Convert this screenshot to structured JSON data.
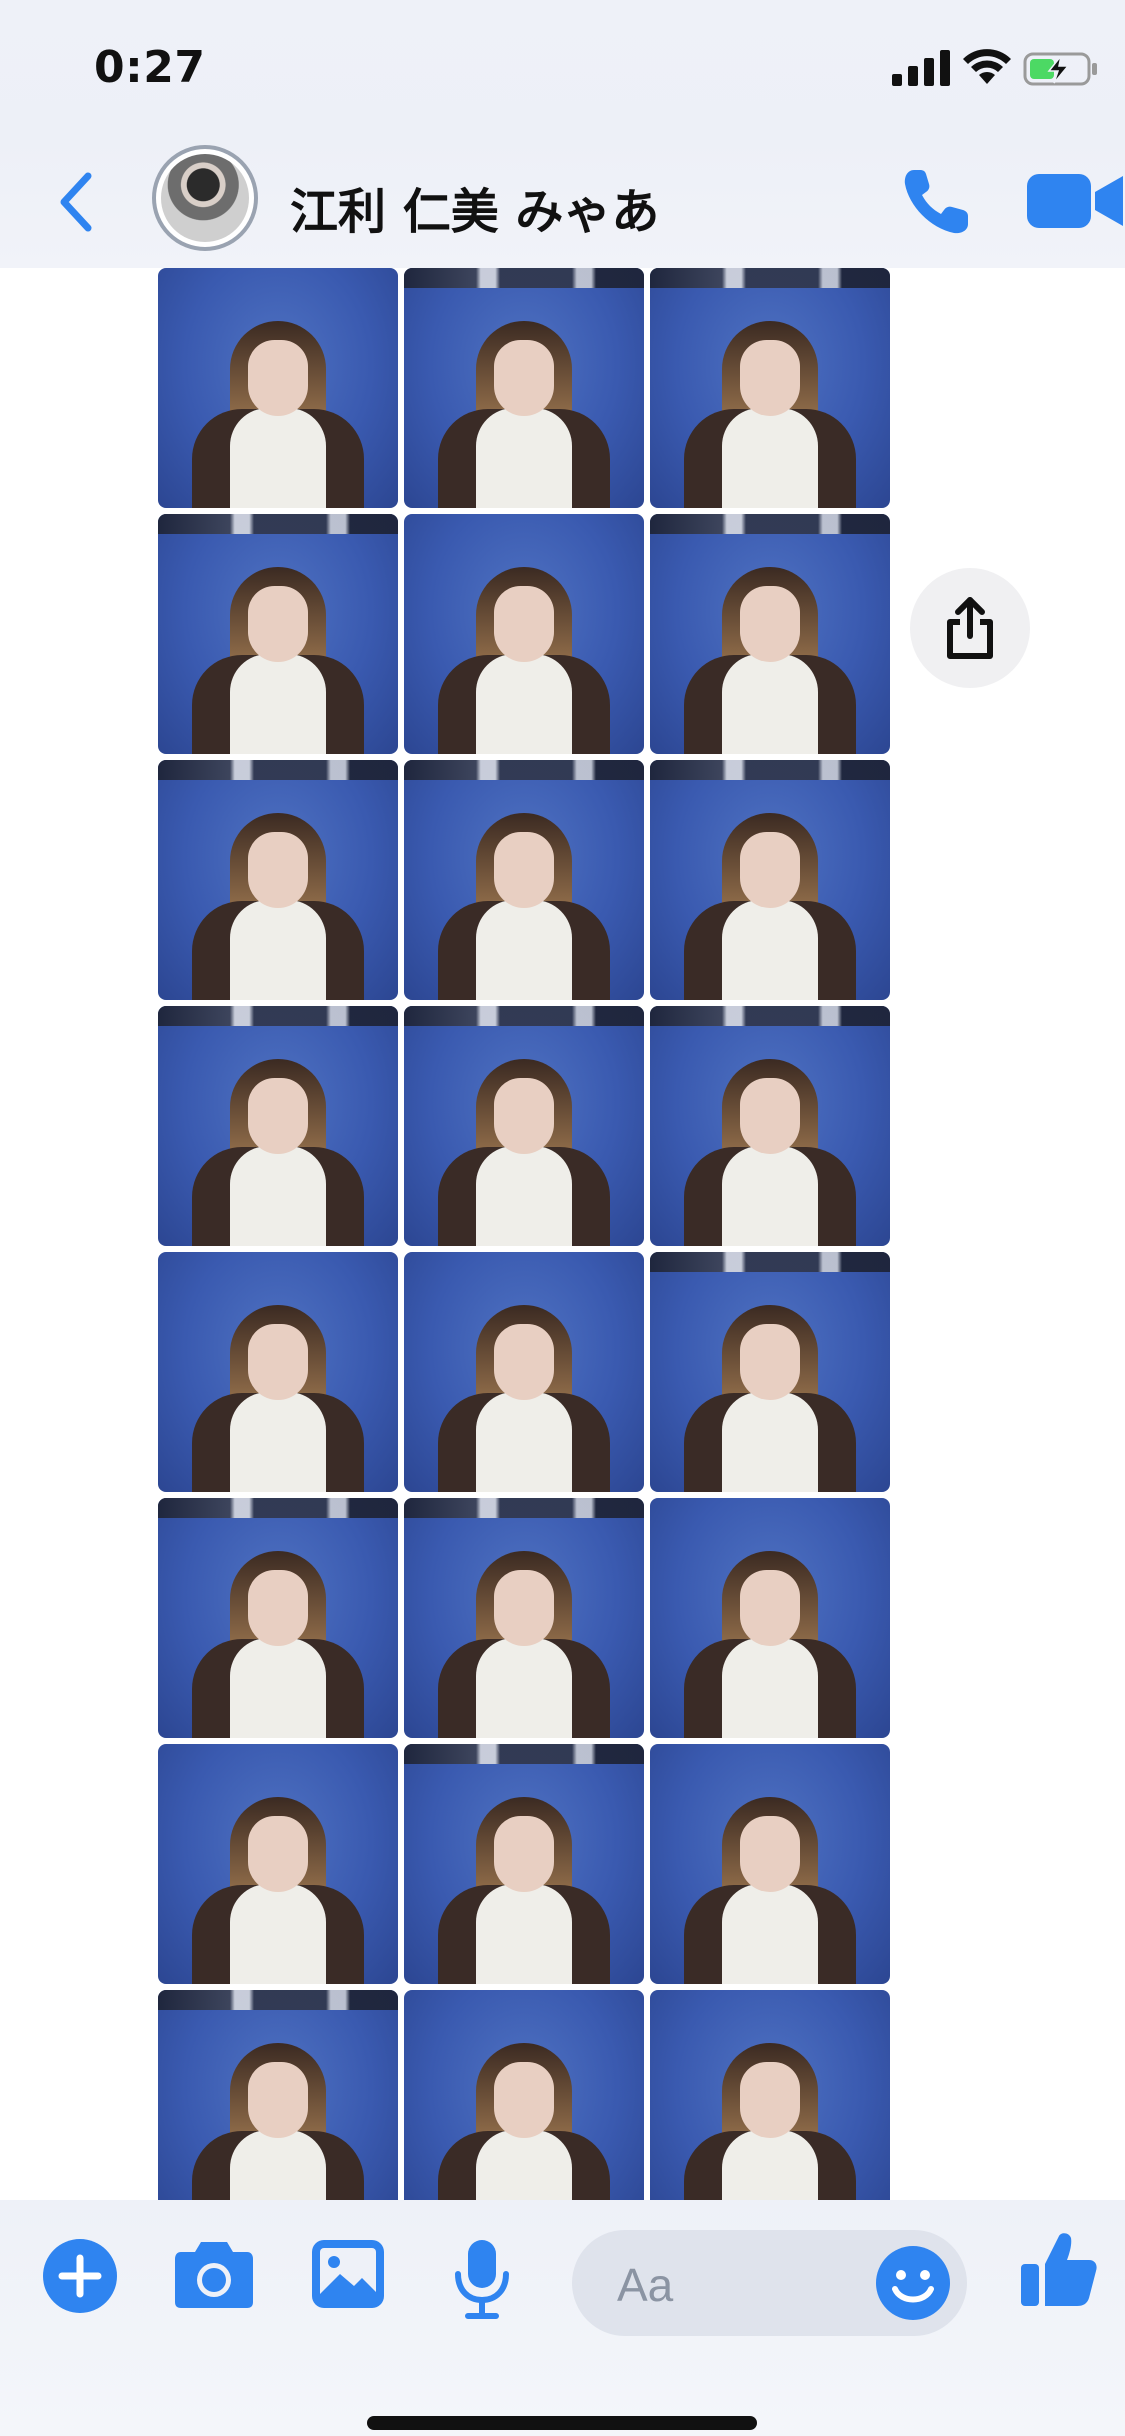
{
  "status_bar": {
    "time": "0:27",
    "battery_charging": true,
    "battery_level": 0.4
  },
  "header": {
    "contact_name": "江利 仁美 みゃあ",
    "icons": [
      "back-chevron",
      "avatar",
      "phone-call",
      "video-call"
    ]
  },
  "media": {
    "count": 24,
    "columns": 3,
    "items": [
      {
        "zoom_bar": false
      },
      {
        "zoom_bar": true
      },
      {
        "zoom_bar": true
      },
      {
        "zoom_bar": true
      },
      {
        "zoom_bar": false
      },
      {
        "zoom_bar": true
      },
      {
        "zoom_bar": true
      },
      {
        "zoom_bar": true
      },
      {
        "zoom_bar": true
      },
      {
        "zoom_bar": true
      },
      {
        "zoom_bar": true
      },
      {
        "zoom_bar": true
      },
      {
        "zoom_bar": false
      },
      {
        "zoom_bar": false
      },
      {
        "zoom_bar": true
      },
      {
        "zoom_bar": true
      },
      {
        "zoom_bar": true
      },
      {
        "zoom_bar": false
      },
      {
        "zoom_bar": false
      },
      {
        "zoom_bar": true
      },
      {
        "zoom_bar": false
      },
      {
        "zoom_bar": true
      },
      {
        "zoom_bar": false
      },
      {
        "zoom_bar": false
      }
    ]
  },
  "share_button": {
    "icon": "share-icon"
  },
  "composer": {
    "placeholder": "Aa",
    "icons": [
      "plus-icon",
      "camera-icon",
      "gallery-icon",
      "microphone-icon",
      "emoji-icon",
      "thumbs-up-icon"
    ]
  },
  "colors": {
    "accent": "#2f84f0",
    "header_bg": "#edf0f7",
    "photo_bg": "#3a5ab0"
  }
}
